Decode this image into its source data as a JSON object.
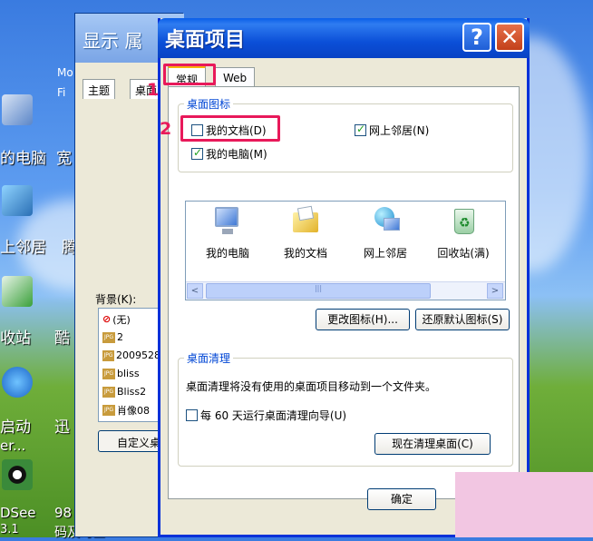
{
  "desktop": {
    "labels": [
      "的电脑",
      "宽",
      "上邻居",
      "腾",
      "收站",
      "酷",
      "启动",
      "迅",
      "er...",
      "DSee",
      "98",
      "3.1",
      "码及时查"
    ],
    "window_hints": [
      "Mo",
      "Fi"
    ]
  },
  "bg_window": {
    "title": "显示 属",
    "tabs": [
      "主题",
      "桌面"
    ],
    "background_label": "背景(K):",
    "items": [
      "(无)",
      "2",
      "2009528",
      "bliss",
      "Bliss2",
      "肖像08"
    ],
    "customize_button": "自定义桌"
  },
  "dialog": {
    "title": "桌面项目",
    "help_symbol": "?",
    "close_symbol": "✕",
    "tabs": [
      "常规",
      "Web"
    ],
    "desktop_icons_group": "桌面图标",
    "checkboxes": [
      {
        "label": "我的文档(D)",
        "checked": false
      },
      {
        "label": "网上邻居(N)",
        "checked": true
      },
      {
        "label": "我的电脑(M)",
        "checked": true
      }
    ],
    "icons": [
      {
        "label": "我的电脑",
        "icon": "my-computer-icon"
      },
      {
        "label": "我的文档",
        "icon": "my-documents-icon"
      },
      {
        "label": "网上邻居",
        "icon": "network-places-icon"
      },
      {
        "label": "回收站(满)",
        "icon": "recycle-bin-full-icon"
      }
    ],
    "scroll_left": "<",
    "scroll_right": ">",
    "change_icon_button": "更改图标(H)...",
    "restore_default_button": "还原默认图标(S)",
    "cleanup_group": "桌面清理",
    "cleanup_desc": "桌面清理将没有使用的桌面项目移动到一个文件夹。",
    "cleanup_checkbox": {
      "label": "每 60 天运行桌面清理向导(U)",
      "checked": false
    },
    "cleanup_now_button": "现在清理桌面(C)",
    "ok_button": "确定"
  },
  "annotations": {
    "step1": "1",
    "step2": "2",
    "accent": "#e8195a"
  }
}
